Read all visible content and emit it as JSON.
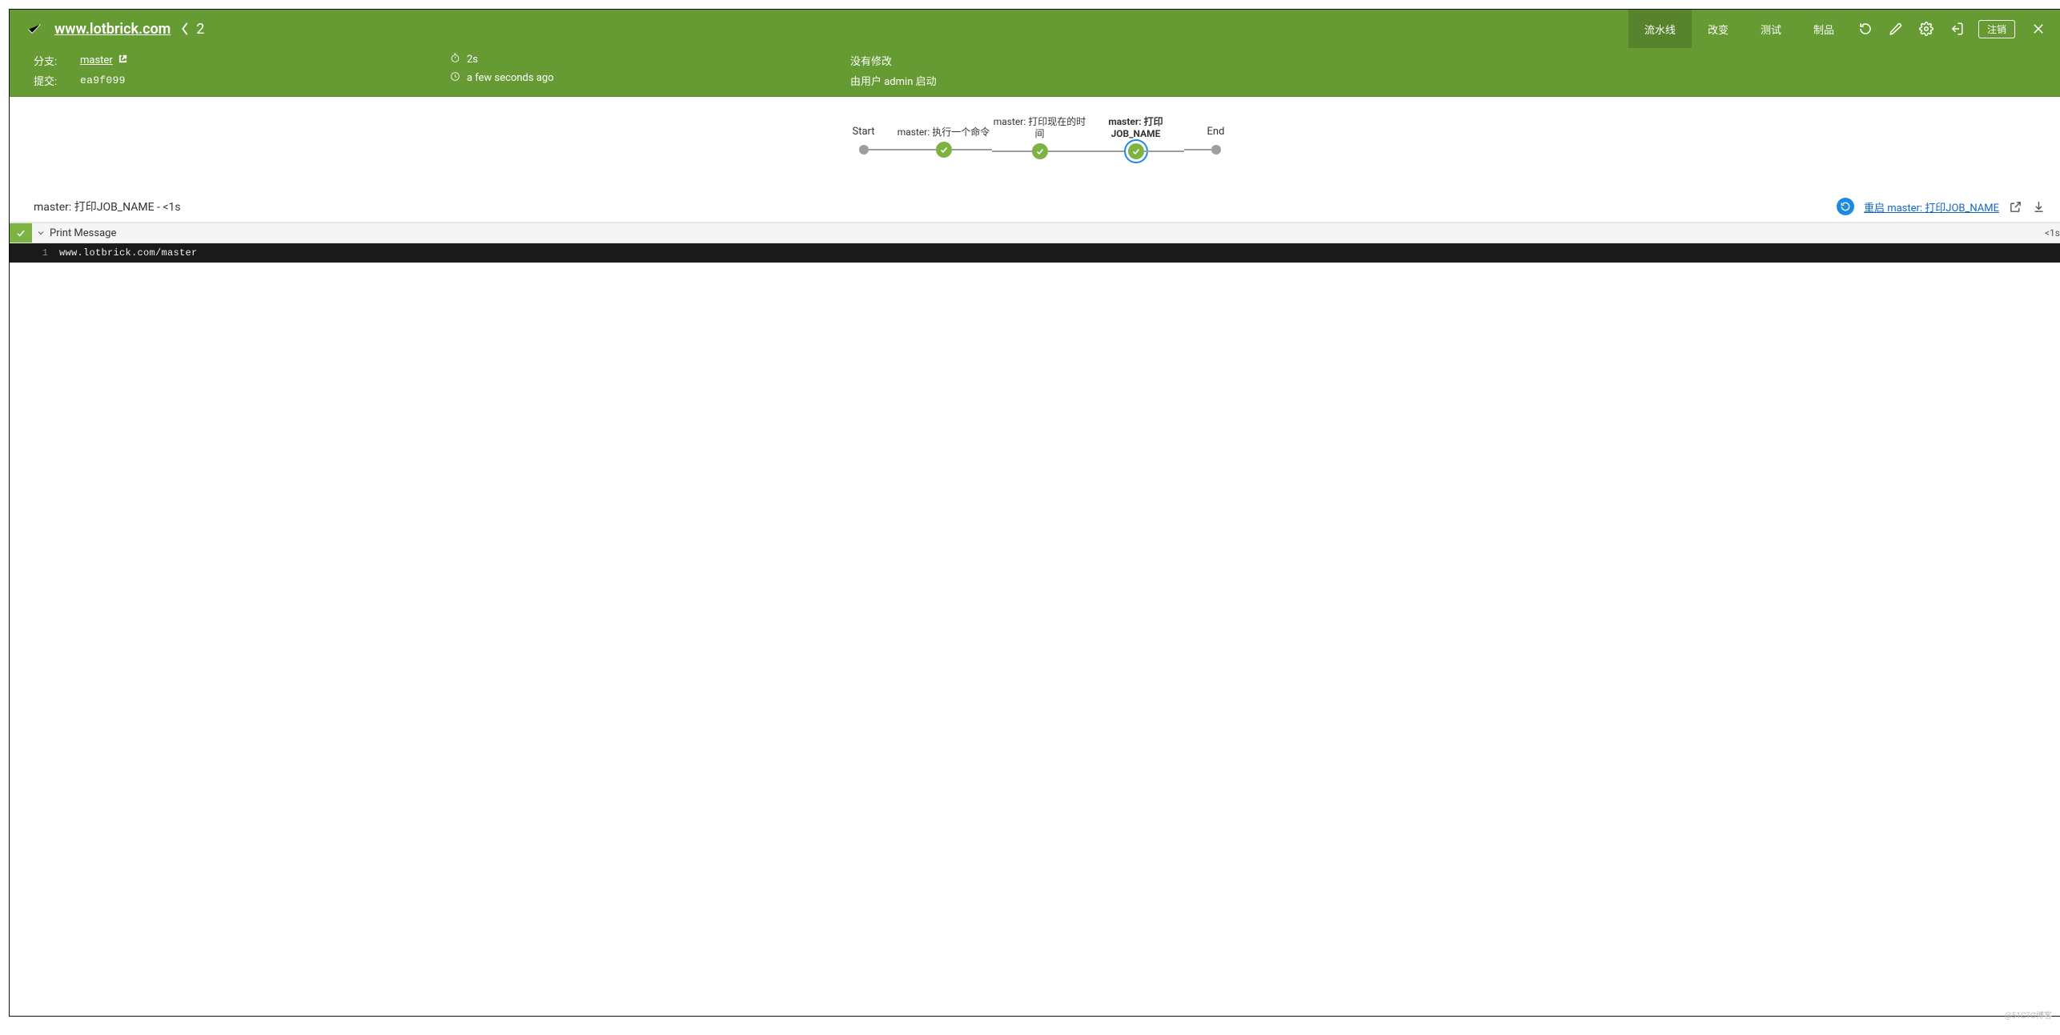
{
  "header": {
    "pipeline_name": "www.lotbrick.com",
    "run_number": "2",
    "tabs": {
      "pipeline": "流水线",
      "changes": "改变",
      "tests": "测试",
      "artifacts": "制品"
    },
    "active_tab": "pipeline",
    "logout_label": "注销"
  },
  "meta": {
    "branch_label": "分支:",
    "branch_value": "master",
    "commit_label": "提交:",
    "commit_value": "ea9f099",
    "duration_value": "2s",
    "started_value": "a few seconds ago",
    "no_changes": "没有修改",
    "started_by": "由用户 admin 启动"
  },
  "pipeline": {
    "stages": [
      {
        "id": "start",
        "label": "Start",
        "type": "terminal"
      },
      {
        "id": "s1",
        "label": "master: 执行一个命令",
        "type": "success"
      },
      {
        "id": "s2",
        "label": "master: 打印现在的时间",
        "type": "success"
      },
      {
        "id": "s3",
        "label": "master: 打印JOB_NAME",
        "type": "success",
        "selected": true
      },
      {
        "id": "end",
        "label": "End",
        "type": "terminal"
      }
    ]
  },
  "step_section": {
    "title": "master: 打印JOB_NAME - <1s",
    "rerun_link": "重启 master: 打印JOB_NAME"
  },
  "step": {
    "name": "Print Message",
    "duration": "<1s"
  },
  "log": {
    "line_number": "1",
    "text": "www.lotbrick.com/master"
  },
  "watermark": "@51CTO博客"
}
